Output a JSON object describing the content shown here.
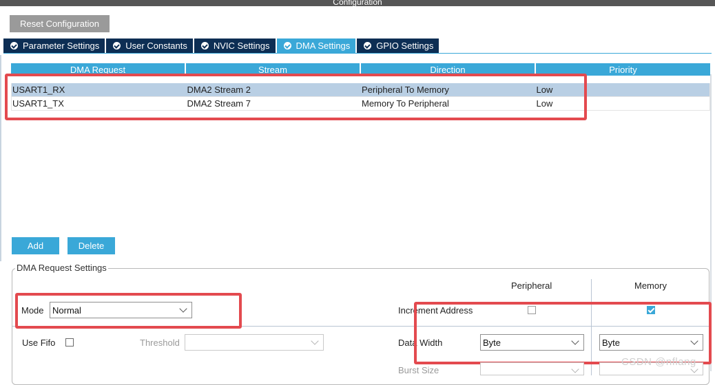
{
  "window": {
    "title": "Configuration"
  },
  "toolbar": {
    "reset_label": "Reset Configuration"
  },
  "tabs": [
    {
      "label": "Parameter Settings",
      "active": false
    },
    {
      "label": "User Constants",
      "active": false
    },
    {
      "label": "NVIC Settings",
      "active": false
    },
    {
      "label": "DMA Settings",
      "active": true
    },
    {
      "label": "GPIO Settings",
      "active": false
    }
  ],
  "dma_table": {
    "columns": [
      "DMA Request",
      "Stream",
      "Direction",
      "Priority"
    ],
    "rows": [
      {
        "request": "USART1_RX",
        "stream": "DMA2 Stream 2",
        "direction": "Peripheral To Memory",
        "priority": "Low",
        "selected": true
      },
      {
        "request": "USART1_TX",
        "stream": "DMA2 Stream 7",
        "direction": "Memory To Peripheral",
        "priority": "Low",
        "selected": false
      }
    ]
  },
  "actions": {
    "add_label": "Add",
    "delete_label": "Delete"
  },
  "settings": {
    "group_title": "DMA Request Settings",
    "col_peripheral": "Peripheral",
    "col_memory": "Memory",
    "mode_label": "Mode",
    "mode_value": "Normal",
    "increment_label": "Increment Address",
    "increment_peripheral_checked": false,
    "increment_memory_checked": true,
    "use_fifo_label": "Use Fifo",
    "use_fifo_checked": false,
    "threshold_label": "Threshold",
    "threshold_value": "",
    "data_width_label": "Data Width",
    "data_width_peripheral": "Byte",
    "data_width_memory": "Byte",
    "burst_size_label": "Burst Size"
  },
  "watermark": "CSDN @nflang",
  "colors": {
    "accent": "#3aa8d8",
    "tab_bg": "#0d2e54",
    "highlight": "#e34a4f",
    "selected_row": "#b9cfe4"
  }
}
